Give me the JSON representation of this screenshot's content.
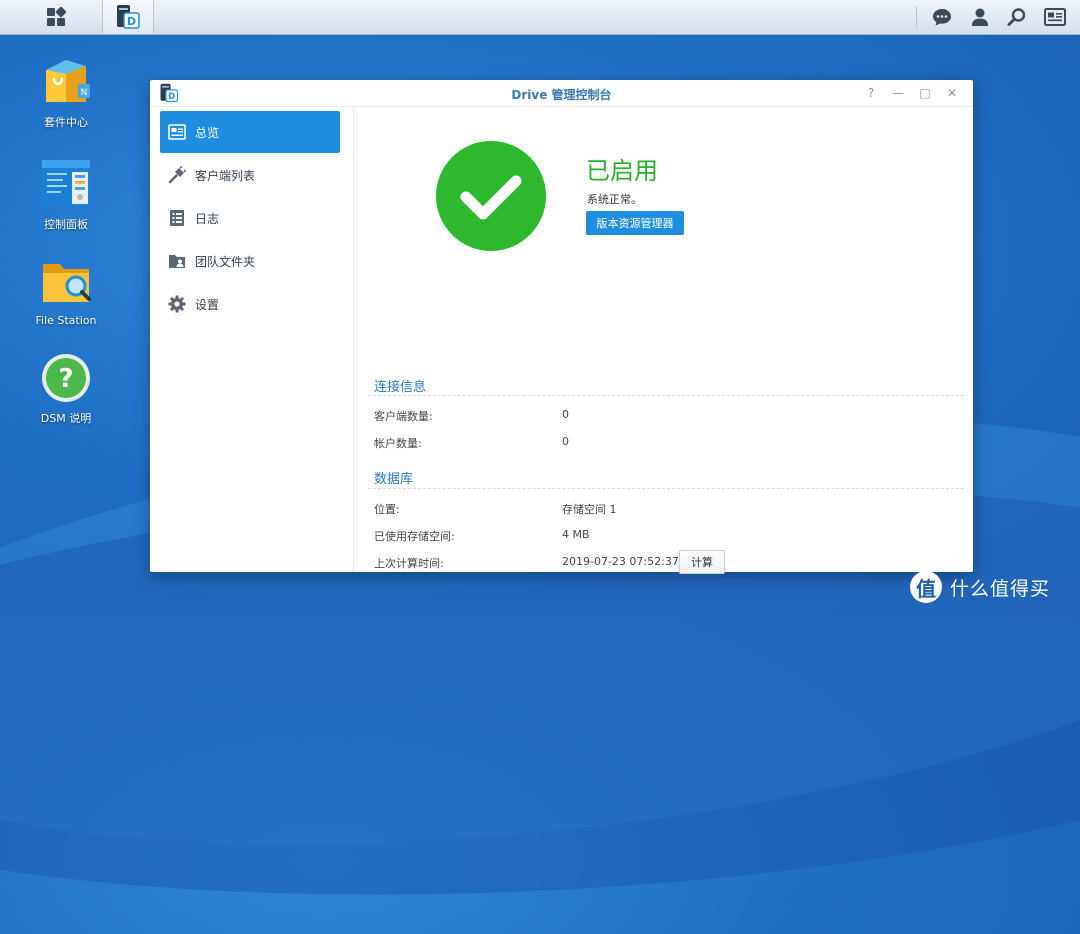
{
  "taskbar": {
    "main_menu_icon": "grid-icon",
    "open_app_icon": "drive-icon",
    "right_icons": [
      "chat-icon",
      "user-icon",
      "search-icon",
      "widgets-icon"
    ]
  },
  "desktop": {
    "icons": [
      {
        "label": "套件中心",
        "icon": "package-center-icon"
      },
      {
        "label": "控制面板",
        "icon": "control-panel-icon"
      },
      {
        "label": "File Station",
        "icon": "file-station-icon"
      },
      {
        "label": "DSM 说明",
        "icon": "help-icon"
      }
    ]
  },
  "window": {
    "title": "Drive 管理控制台",
    "controls": {
      "help": "?",
      "minimize": "—",
      "maximize": "□",
      "close": "✕"
    },
    "sidebar": {
      "items": [
        {
          "label": "总览",
          "icon": "overview-icon",
          "active": true
        },
        {
          "label": "客户端列表",
          "icon": "plug-icon",
          "active": false
        },
        {
          "label": "日志",
          "icon": "log-icon",
          "active": false
        },
        {
          "label": "团队文件夹",
          "icon": "team-folder-icon",
          "active": false
        },
        {
          "label": "设置",
          "icon": "gear-icon",
          "active": false
        }
      ]
    },
    "status": {
      "title": "已启用",
      "subtitle": "系统正常。",
      "button": "版本资源管理器",
      "icon": "check-icon",
      "color": "#2db82d"
    },
    "connection": {
      "title": "连接信息",
      "rows": [
        {
          "label": "客户端数量:",
          "value": "0"
        },
        {
          "label": "帐户数量:",
          "value": "0"
        }
      ]
    },
    "database": {
      "title": "数据库",
      "rows": [
        {
          "label": "位置:",
          "value": "存储空间 1"
        },
        {
          "label": "已使用存储空间:",
          "value": "4 MB"
        },
        {
          "label": "上次计算时间:",
          "value": "2019-07-23 07:52:37"
        }
      ],
      "calc_button": "计算"
    }
  },
  "watermark": {
    "logo": "值",
    "text": "什么值得买"
  },
  "colors": {
    "accent": "#1f8ee0",
    "success": "#2db82d",
    "section_title": "#2b7bc4"
  }
}
